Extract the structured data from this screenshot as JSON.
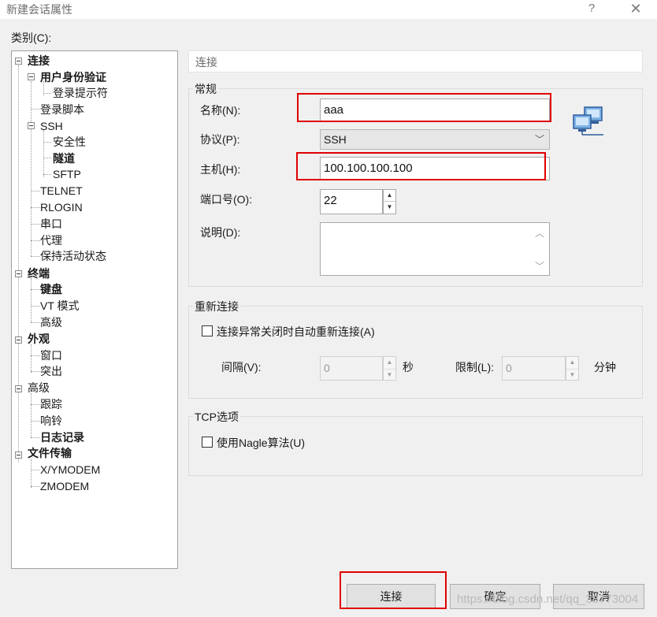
{
  "window": {
    "title": "新建会话属性",
    "help": "?",
    "close": "✕"
  },
  "category_label": "类别(C):",
  "tree": [
    {
      "label": "连接",
      "bold": true
    },
    {
      "label": "用户身份验证",
      "bold": true
    },
    {
      "label": "登录提示符",
      "bold": false
    },
    {
      "label": "登录脚本",
      "bold": false
    },
    {
      "label": "SSH",
      "bold": false
    },
    {
      "label": "安全性",
      "bold": false
    },
    {
      "label": "隧道",
      "bold": true
    },
    {
      "label": "SFTP",
      "bold": false
    },
    {
      "label": "TELNET",
      "bold": false
    },
    {
      "label": "RLOGIN",
      "bold": false
    },
    {
      "label": "串口",
      "bold": false
    },
    {
      "label": "代理",
      "bold": false
    },
    {
      "label": "保持活动状态",
      "bold": false
    },
    {
      "label": "终端",
      "bold": true
    },
    {
      "label": "键盘",
      "bold": true
    },
    {
      "label": "VT 模式",
      "bold": false
    },
    {
      "label": "高级",
      "bold": false
    },
    {
      "label": "外观",
      "bold": true
    },
    {
      "label": "窗口",
      "bold": false
    },
    {
      "label": "突出",
      "bold": false
    },
    {
      "label": "高级",
      "bold": false
    },
    {
      "label": "跟踪",
      "bold": false
    },
    {
      "label": "响铃",
      "bold": false
    },
    {
      "label": "日志记录",
      "bold": true
    },
    {
      "label": "文件传输",
      "bold": true
    },
    {
      "label": "X/YMODEM",
      "bold": false
    },
    {
      "label": "ZMODEM",
      "bold": false
    }
  ],
  "panel": {
    "header": "连接",
    "general": {
      "title": "常规",
      "name_label": "名称(N):",
      "name_value": "aaa",
      "protocol_label": "协议(P):",
      "protocol_value": "SSH",
      "host_label": "主机(H):",
      "host_value": "100.100.100.100",
      "port_label": "端口号(O):",
      "port_value": "22",
      "desc_label": "说明(D):"
    },
    "reconnect": {
      "title": "重新连接",
      "auto_label": "连接异常关闭时自动重新连接(A)",
      "interval_label": "间隔(V):",
      "interval_value": "0",
      "interval_unit": "秒",
      "limit_label": "限制(L):",
      "limit_value": "0",
      "limit_unit": "分钟"
    },
    "tcp": {
      "title": "TCP选项",
      "nagle_label": "使用Nagle算法(U)"
    }
  },
  "buttons": {
    "connect": "连接",
    "ok": "确定",
    "cancel": "取消"
  },
  "watermark": "https://blog.csdn.net/qq_38773004",
  "icons": {
    "network": "network-computers-icon",
    "dropdown": "chevron-down-icon"
  }
}
